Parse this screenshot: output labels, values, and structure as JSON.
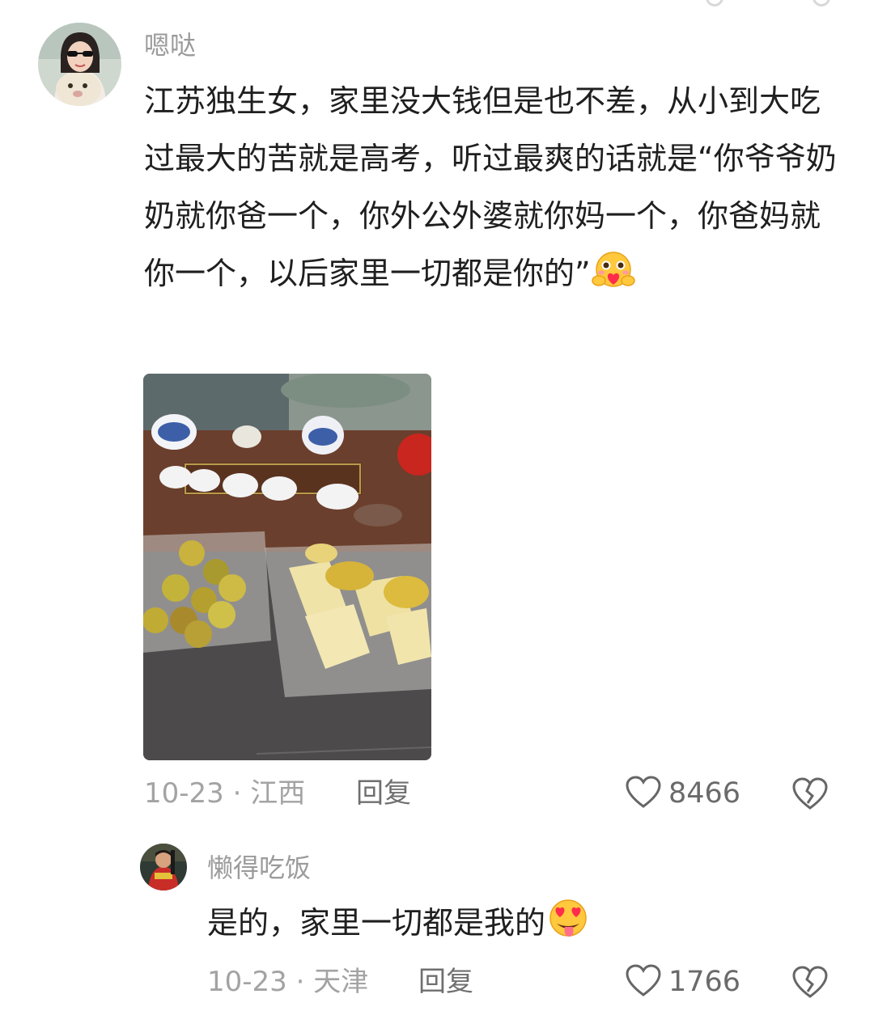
{
  "comment": {
    "username": "嗯哒",
    "text": "江苏独生女，家里没大钱但是也不差，从小到大吃过最大的苦就是高考，听过最爽的话就是“你爷爷奶奶就你爸一个，你外公外婆就你妈一个，你爸妈就你一个，以后家里一切都是你的”",
    "emoji": "hugging-heart-emoji",
    "date": "10-23",
    "location": "江西",
    "meta": "10-23 · 江西",
    "reply_label": "回复",
    "likes": "8466"
  },
  "reply": {
    "username": "懒得吃饭",
    "text": "是的，家里一切都是我的",
    "emoji": "heart-eyes-tongue-emoji",
    "date": "10-23",
    "location": "天津",
    "meta": "10-23 · 天津",
    "reply_label": "回复",
    "likes": "1766"
  },
  "icons": {
    "like": "heart-outline-icon",
    "dislike": "broken-heart-icon"
  },
  "colors": {
    "username": "#9b9b9b",
    "text": "#1f1f1f",
    "meta": "#a3a3a3",
    "icon": "#666666"
  }
}
